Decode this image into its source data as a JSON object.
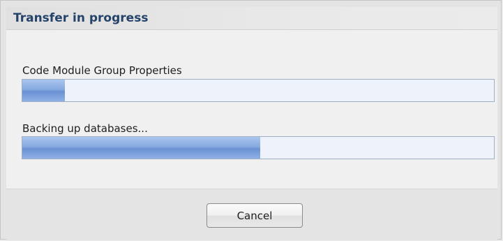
{
  "dialog": {
    "title": "Transfer in progress"
  },
  "tasks": [
    {
      "label": "Code Module Group Properties",
      "progress_fraction": 0.09
    },
    {
      "label": "Backing up databases...",
      "progress_fraction": 0.505
    }
  ],
  "footer": {
    "cancel_label": "Cancel"
  },
  "colors": {
    "title_text": "#25436a",
    "progress_fill": "#6b91d3",
    "progress_track": "#eef3fb"
  }
}
